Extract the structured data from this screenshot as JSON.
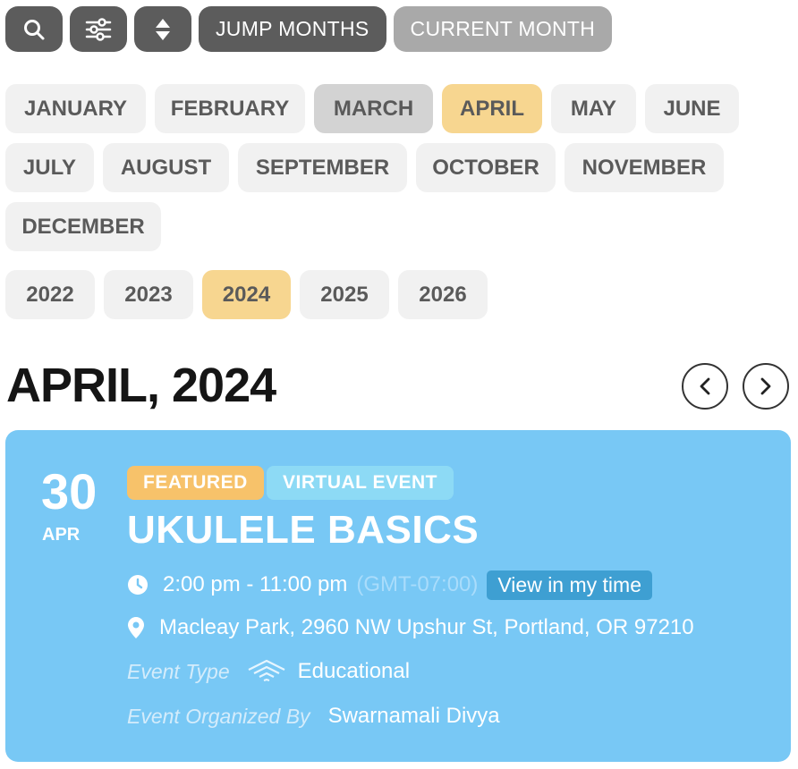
{
  "toolbar": {
    "icons": [
      "search-icon",
      "filter-sliders-icon",
      "sort-updown-icon"
    ],
    "jump_months": "JUMP MONTHS",
    "current_month": "CURRENT MONTH"
  },
  "months": [
    "JANUARY",
    "FEBRUARY",
    "MARCH",
    "APRIL",
    "MAY",
    "JUNE",
    "JULY",
    "AUGUST",
    "SEPTEMBER",
    "OCTOBER",
    "NOVEMBER",
    "DECEMBER"
  ],
  "current_month_highlight": "MARCH",
  "selected_month": "APRIL",
  "years": [
    "2022",
    "2023",
    "2024",
    "2025",
    "2026"
  ],
  "selected_year": "2024",
  "heading": "APRIL, 2024",
  "event": {
    "day": "30",
    "month": "APR",
    "badges": [
      "FEATURED",
      "VIRTUAL EVENT"
    ],
    "title": "UKULELE BASICS",
    "time": "2:00 pm - 11:00 pm",
    "timezone": "(GMT-07:00)",
    "view_my_time": "View in my time",
    "location": "Macleay Park, 2960 NW Upshur St, Portland, OR 97210",
    "type_label": "Event Type",
    "type_value": "Educational",
    "organizer_label": "Event Organized By",
    "organizer": "Swarnamali Divya"
  },
  "colors": {
    "card": "#78c8f5",
    "selected": "#f7d690",
    "featured": "#f7c26a",
    "virtual": "#8ddaf5",
    "tz_button": "#3e9fd2"
  }
}
